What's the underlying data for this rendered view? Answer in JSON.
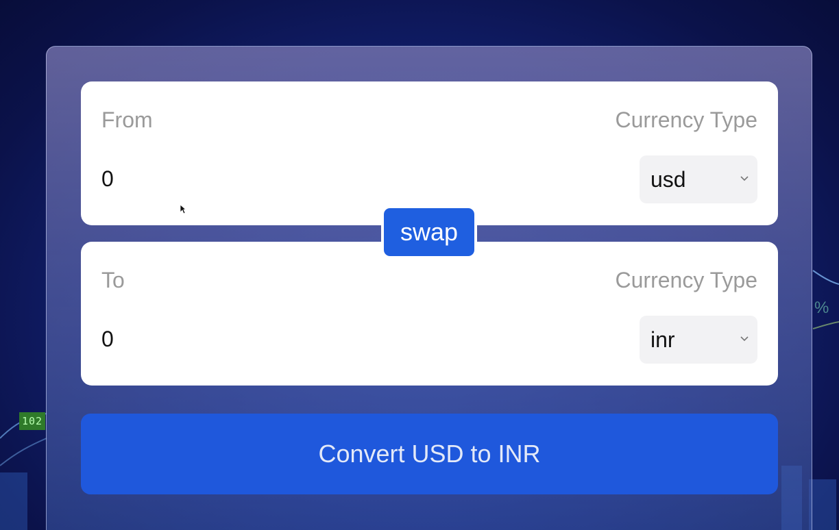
{
  "background": {
    "badge_text": "102",
    "percent_text": "%"
  },
  "from_card": {
    "label": "From",
    "currency_type_label": "Currency Type",
    "amount_value": "0",
    "currency_selected": "usd"
  },
  "to_card": {
    "label": "To",
    "currency_type_label": "Currency Type",
    "amount_value": "0",
    "currency_selected": "inr"
  },
  "swap_label": "swap",
  "convert_label": "Convert USD to INR",
  "colors": {
    "accent": "#1f58dc",
    "card_background": "#ffffff",
    "muted_text": "#9a9a9a"
  },
  "icons": {
    "select_chevron": "chevron-down-icon",
    "pointer": "mouse-cursor-icon"
  }
}
